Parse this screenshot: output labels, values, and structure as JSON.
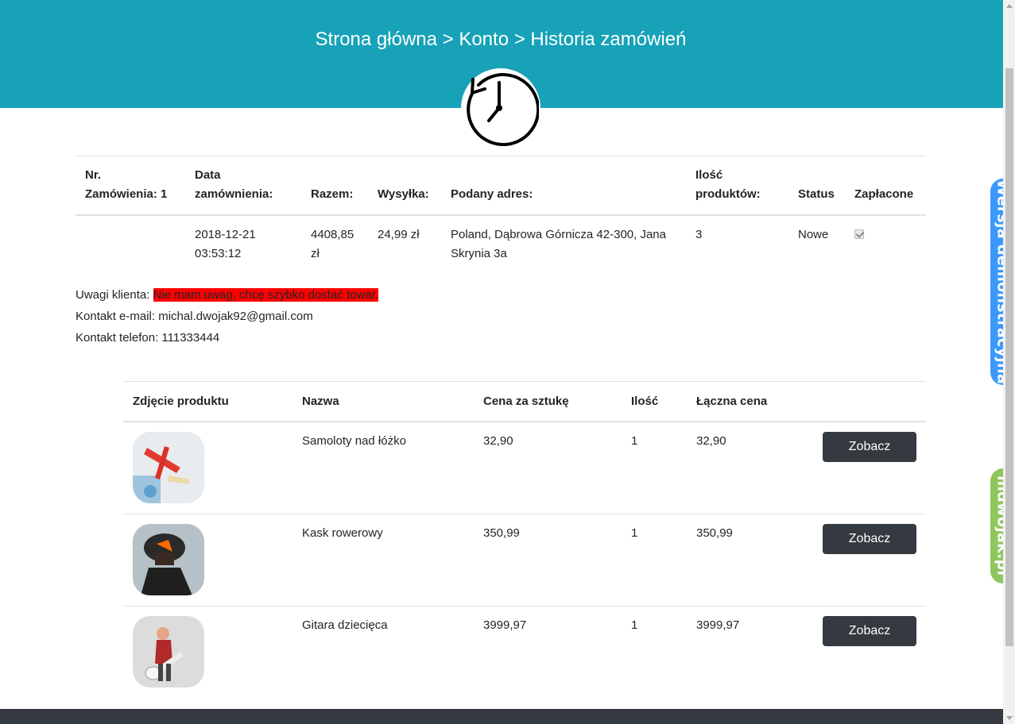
{
  "header": {
    "breadcrumb": "Strona główna > Konto > Historia zamówień"
  },
  "order_table": {
    "headers": {
      "nr": "Nr. Zamówienia: 1",
      "date": "Data zamównienia:",
      "total": "Razem:",
      "shipping": "Wysyłka:",
      "address": "Podany adres:",
      "quantity": "Ilość produktów:",
      "status": "Status",
      "paid": "Zapłacone"
    },
    "row": {
      "date": "2018-12-21 03:53:12",
      "total": "4408,85 zł",
      "shipping": "24,99 zł",
      "address": "Poland, Dąbrowa Górnicza 42-300, Jana Skrynia 3a",
      "quantity": "3",
      "status": "Nowe",
      "paid": true
    }
  },
  "customer_info": {
    "notes_label": "Uwagi klienta: ",
    "notes_value": "Nie mam uwag, chcę szybko dostać towar.",
    "email_label": "Kontakt e-mail: ",
    "email_value": "michal.dwojak92@gmail.com",
    "phone_label": "Kontakt telefon: ",
    "phone_value": "111333444",
    "highlight_color": "#ff0000"
  },
  "products_table": {
    "headers": {
      "photo": "Zdjęcie produktu",
      "name": "Nazwa",
      "unit_price": "Cena za sztukę",
      "qty": "Ilość",
      "total": "Łączna cena"
    },
    "rows": [
      {
        "name": "Samoloty nad łóżko",
        "unit_price": "32,90",
        "qty": "1",
        "total": "32,90",
        "button": "Zobacz",
        "image": "toy-airplanes-photo"
      },
      {
        "name": "Kask rowerowy",
        "unit_price": "350,99",
        "qty": "1",
        "total": "350,99",
        "button": "Zobacz",
        "image": "bike-helmet-photo"
      },
      {
        "name": "Gitara dziecięca",
        "unit_price": "3999,97",
        "qty": "1",
        "total": "3999,97",
        "button": "Zobacz",
        "image": "kid-guitar-photo"
      }
    ]
  },
  "side_tabs": {
    "demo": "Wersja demonstracyjna",
    "site": "mdwojak.pl"
  },
  "colors": {
    "header_bg": "#17a2b8",
    "button_bg": "#343a40",
    "footer_bg": "#343a40",
    "demo_tab": "#3b99fc",
    "site_tab": "#8fc75e"
  }
}
